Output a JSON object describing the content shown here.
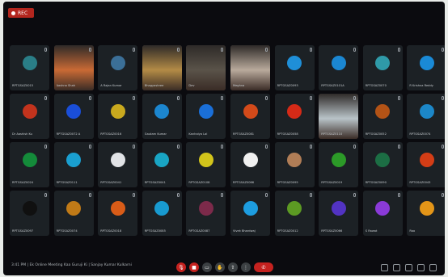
{
  "recording": {
    "label": "REC"
  },
  "participants": [
    {
      "name": "RPTGSAZ0015",
      "avatar_color": "#2a7e87"
    },
    {
      "name": "Aashna Shah",
      "avatar_color": "#c96a35",
      "video": true
    },
    {
      "name": "A Rajan Kumar",
      "avatar_color": "#3b6f97"
    },
    {
      "name": "Bhagyashree",
      "avatar_color": "#b38b46",
      "video": true
    },
    {
      "name": "Dev",
      "avatar_color": "#5a5349",
      "video": true
    },
    {
      "name": "Meghna",
      "avatar_color": "#b9aa9c",
      "video": true
    },
    {
      "name": "RPTGSAZ0093",
      "avatar_color": "#1f8fd8"
    },
    {
      "name": "RPTGSAZ0101A",
      "avatar_color": "#1b87d2"
    },
    {
      "name": "RPTGSAZ0070",
      "avatar_color": "#2f9aa8"
    },
    {
      "name": "R Krishna Reddy",
      "avatar_color": "#1a8ad6"
    },
    {
      "name": "Dr Aashish Ku",
      "avatar_color": "#c2331d"
    },
    {
      "name": "RPTGSAZ0072 A",
      "avatar_color": "#1a4ed8"
    },
    {
      "name": "RPTGSAZ0016",
      "avatar_color": "#c9a91e"
    },
    {
      "name": "Gautam Kumar",
      "avatar_color": "#1c86cf"
    },
    {
      "name": "Kanhaiya Lal",
      "avatar_color": "#1a6fd8"
    },
    {
      "name": "RPTGSAZ0081",
      "avatar_color": "#d34a1a"
    },
    {
      "name": "RPTGSAZ0058",
      "avatar_color": "#d52a17"
    },
    {
      "name": "RPTGSAZ0110",
      "avatar_color": "#b9c3c8",
      "video": true
    },
    {
      "name": "RPTGSAZ0052",
      "avatar_color": "#b35316"
    },
    {
      "name": "RPTGSAZ0074",
      "avatar_color": "#1c87c8"
    },
    {
      "name": "RPTGSAZ0024",
      "avatar_color": "#148b3a"
    },
    {
      "name": "RPTGSAZ0111",
      "avatar_color": "#1a9fd0"
    },
    {
      "name": "RPTGSAZ0041",
      "avatar_color": "#e1e3e6"
    },
    {
      "name": "RPTGSAZ0041",
      "avatar_color": "#19a5c4"
    },
    {
      "name": "RPTGSAZ0108",
      "avatar_color": "#d2c41b"
    },
    {
      "name": "RPTGSAZ0066",
      "avatar_color": "#f0f0f0"
    },
    {
      "name": "RPTGSAZ0095",
      "avatar_color": "#b07d56"
    },
    {
      "name": "RPTGSAZ0019",
      "avatar_color": "#2c9a28"
    },
    {
      "name": "RPTGSAZ0090",
      "avatar_color": "#1c6e44"
    },
    {
      "name": "RPTGSAZ0043",
      "avatar_color": "#d33d16"
    },
    {
      "name": "RPTGSAZ0097",
      "avatar_color": "#101010"
    },
    {
      "name": "RPTGSAZ0074",
      "avatar_color": "#c07a17"
    },
    {
      "name": "RPTGSAZ0018",
      "avatar_color": "#d95c18"
    },
    {
      "name": "RPTGSAZ0085",
      "avatar_color": "#189ad0"
    },
    {
      "name": "RPTGSAZ0087",
      "avatar_color": "#7c2a4a"
    },
    {
      "name": "Vivek Bhardwaj",
      "avatar_color": "#1d9de0"
    },
    {
      "name": "RPTGSAZ0012",
      "avatar_color": "#5c9a23"
    },
    {
      "name": "RPTGSAZ0066",
      "avatar_color": "#5233c2"
    },
    {
      "name": "S Rawat",
      "avatar_color": "#8a3ad8"
    },
    {
      "name": "Rao",
      "avatar_color": "#e39518"
    }
  ],
  "meeting": {
    "time": "3:41 PM",
    "title": "Ek Online Meeting Kaa Guruji Ki | Sanjay Kumar Kulkarni"
  },
  "controls": {
    "mic": "microphone-icon",
    "camera": "camera-icon",
    "captions": "captions-icon",
    "raise_hand": "hand-icon",
    "present": "present-icon",
    "more": "more-icon",
    "leave": "leave-call-icon"
  }
}
